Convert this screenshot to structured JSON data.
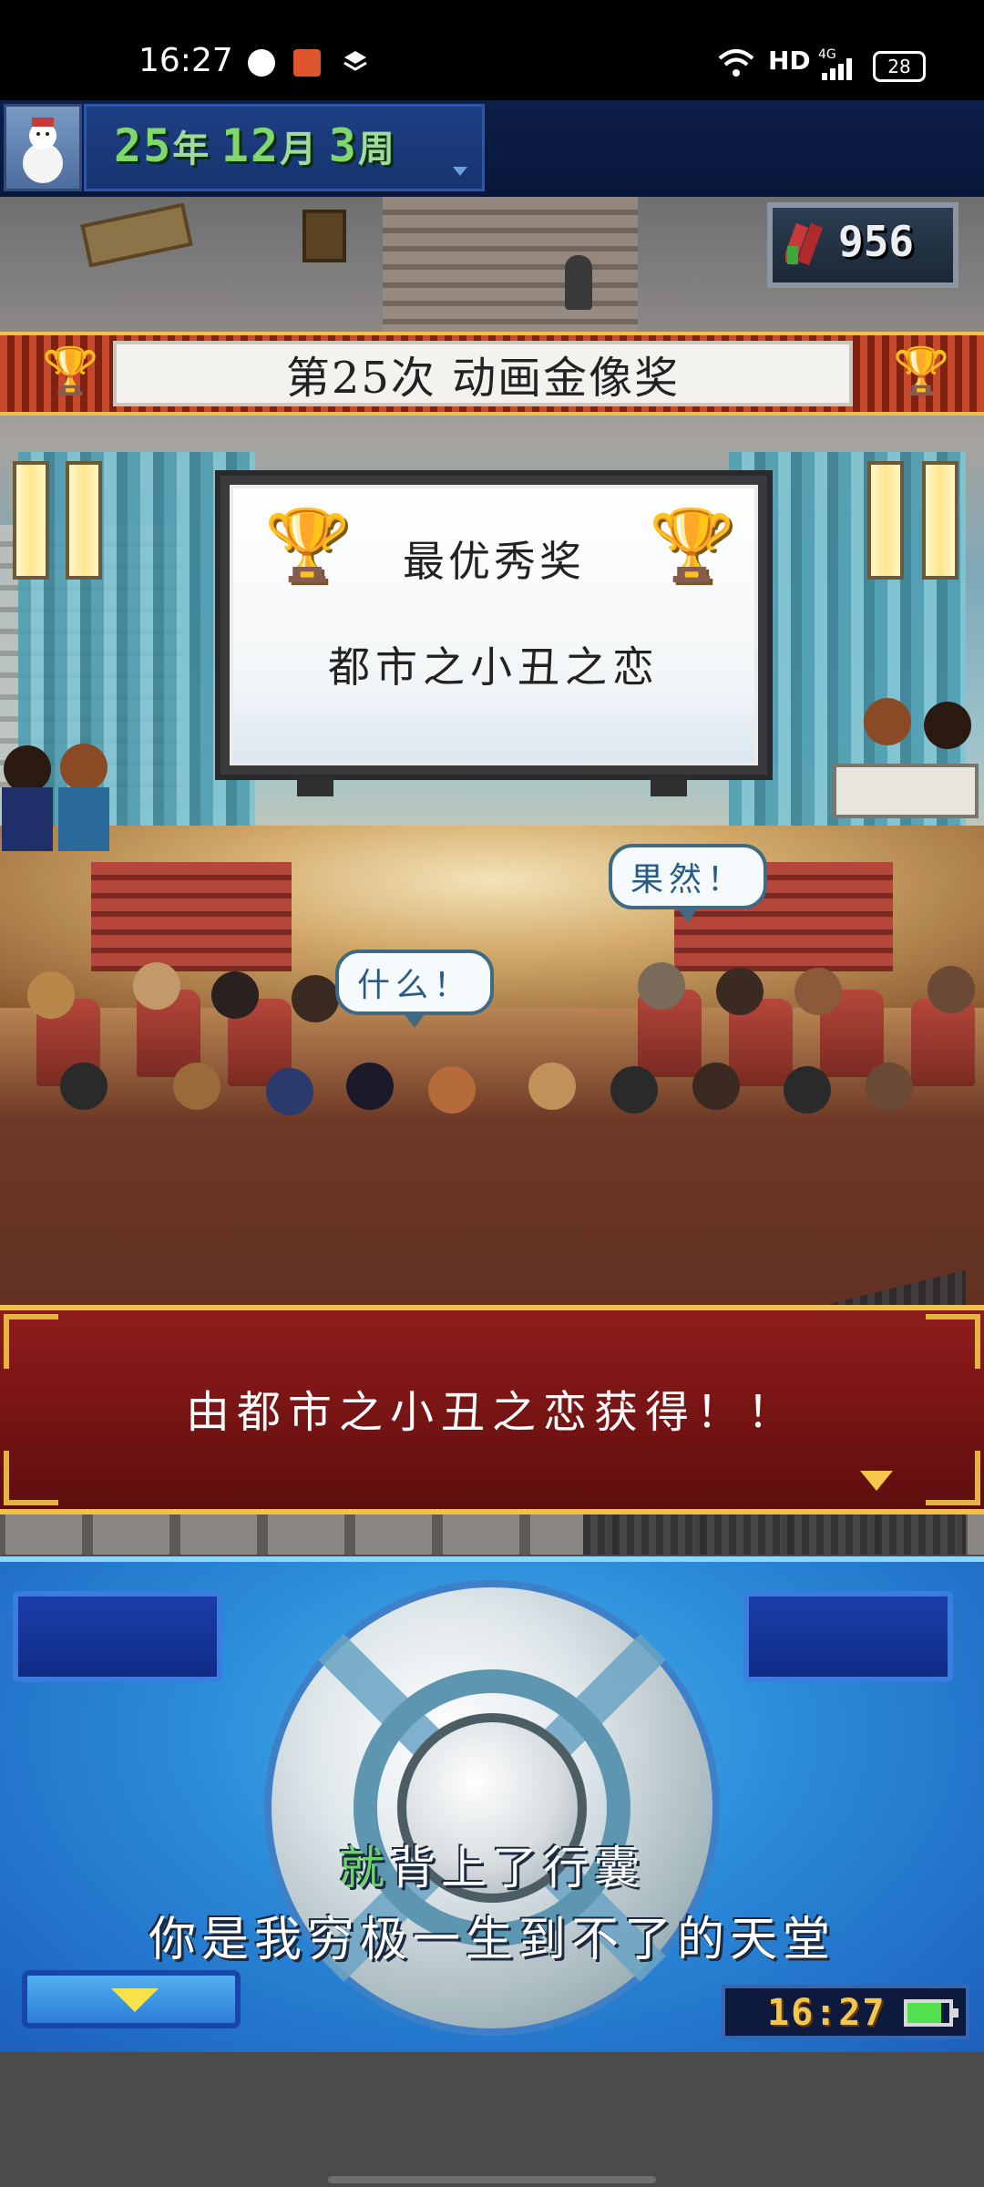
{
  "status_bar": {
    "time": "16:27",
    "network": "HD",
    "signal": "4G",
    "battery": "28",
    "icons": [
      "globe-icon",
      "app-icon",
      "layers-icon",
      "wifi-icon",
      "signal-icon",
      "battery-icon"
    ]
  },
  "date_bar": {
    "year": "25",
    "year_unit": "年",
    "month": "12",
    "month_unit": "月",
    "week": "3",
    "week_unit": "周"
  },
  "funds": {
    "value": "956"
  },
  "award": {
    "banner_title": "第25次 动画金像奖",
    "category": "最优秀奖",
    "winner": "都市之小丑之恋"
  },
  "bubbles": {
    "left": "什么！",
    "right": "果然！"
  },
  "dialog": {
    "text": "由都市之小丑之恋获得！！"
  },
  "lyrics": {
    "line1_highlight": "就",
    "line1_rest": "背上了行囊",
    "line2": "你是我穷极一生到不了的天堂"
  },
  "clock": {
    "time": "16:27",
    "battery_level": 0.8
  },
  "colors": {
    "date_green": "#7fd86a",
    "dialog_red": "#7b1515",
    "gold": "#f2c04a",
    "panel_blue": "#2a8ad8",
    "lyric_highlight": "#6bd46a"
  }
}
